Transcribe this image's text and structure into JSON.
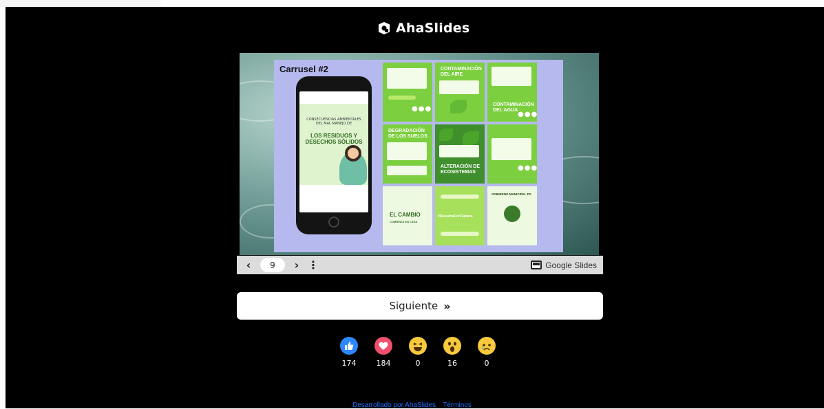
{
  "brand": {
    "name": "AhaSlides"
  },
  "slide": {
    "title": "Carrusel #2",
    "phone_post_heading": "CONSECUENCIAS AMBIENTALES DEL MAL MANEJO DE",
    "phone_post_big": "LOS RESIDUOS Y DESECHOS SÓLIDOS",
    "grid_labels": [
      "CONTAMINACIÓN DEL AIRE",
      "DEGRADACIÓN DE LOS SUELOS",
      "ALTERACIÓN DE ECOSISTEMAS",
      "EL CAMBIO",
      "COMIENZA EN CASA",
      "#DesechaConCabeza",
      "GOBIERNO MUNICIPAL PS"
    ]
  },
  "controls": {
    "prev_icon": "chevron-left-icon",
    "page_number": "9",
    "next_icon": "chevron-right-icon",
    "more_icon": "more-vertical-icon",
    "provider_label": "Google Slides"
  },
  "next_button": {
    "label": "Siguiente",
    "icon": "double-chevron-right-icon"
  },
  "reactions": [
    {
      "name": "like",
      "count": "174",
      "color": "#2d88ff"
    },
    {
      "name": "love",
      "count": "184",
      "color": "#f0506e"
    },
    {
      "name": "haha",
      "count": "0",
      "color": "#f7c93b"
    },
    {
      "name": "wow",
      "count": "16",
      "color": "#f7c93b"
    },
    {
      "name": "sad",
      "count": "0",
      "color": "#f7c93b"
    }
  ],
  "footer": {
    "powered_by": "Desarrollado por AhaSlides",
    "terms": "Términos"
  }
}
